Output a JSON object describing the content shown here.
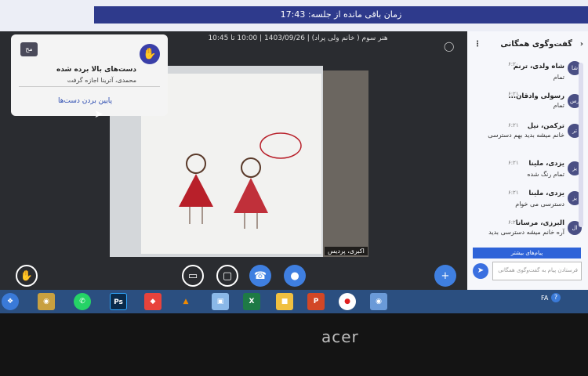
{
  "session": {
    "remaining_time": "زمان باقی مانده از جلسه: 17:43",
    "meeting_info": "هنر سوم ( خانم ولی پراد) | 1403/09/26 | 10:00 تا 10:45"
  },
  "hand_popup": {
    "avatar": "مح",
    "title": "دست‌های بالا برده شده",
    "names": "محمدی، آترینا اجازه گرفت",
    "lower_label": "پایین بردن دست‌ها"
  },
  "video": {
    "name_tag": "اکبری، پردیس"
  },
  "chat": {
    "title": "گفت‌وگوی همگانی",
    "messages": [
      {
        "avatar": "شا",
        "name": "شاه ولدی، ترنم",
        "time": "۶:۲۰",
        "text": "تمام"
      },
      {
        "avatar": "رس",
        "name": "رسولی وادقان...",
        "time": "۶:۲۱",
        "text": "تمام"
      },
      {
        "avatar": "تر",
        "name": "ترکمن، نیل",
        "time": "۶:۲۱",
        "text": "خانم میشه بدید بهم دسترسی"
      },
      {
        "avatar": "یز",
        "name": "یزدی، ملینا",
        "time": "۶:۲۱",
        "text": "تمام رنگ شده"
      },
      {
        "avatar": "یز",
        "name": "یزدی، ملینا",
        "time": "۶:۲۱",
        "text": "دسترسی می خوام"
      },
      {
        "avatar": "ال",
        "name": "البرزی، مرسانا",
        "time": "۶:۲۱",
        "text": "آره خانم میشه دسترسی بدید"
      }
    ],
    "private_button": "پیام‌های بیشتر",
    "input_placeholder": "فرستادن پیام به گفت‌وگوی همگانی"
  },
  "taskbar": {
    "lang": "FA",
    "icons": [
      "start-icon",
      "paint-icon",
      "whatsapp-icon",
      "photoshop-icon",
      "anydesk-icon",
      "vlc-icon",
      "paint-app-icon",
      "excel-icon",
      "files-icon",
      "powerpoint-icon",
      "record-icon",
      "firefox-icon"
    ]
  },
  "hardware": {
    "brand": "acer"
  }
}
